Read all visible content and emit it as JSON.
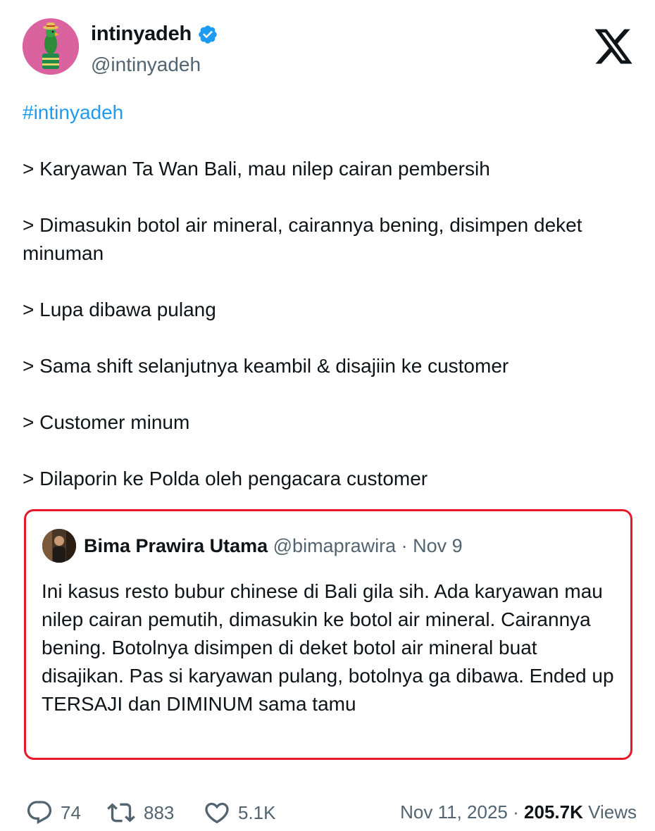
{
  "author": {
    "display_name": "intinyadeh",
    "handle": "@intinyadeh",
    "verified": true
  },
  "brand_logo": "x-logo",
  "post": {
    "hashtag": "#intinyadeh",
    "lines": [
      "> Karyawan Ta Wan Bali, mau nilep cairan pembersih",
      "> Dimasukin botol air mineral, cairannya bening, disimpen deket minuman",
      "> Lupa dibawa pulang",
      "> Sama shift selanjutnya keambil & disajiin ke customer",
      "> Customer minum",
      "> Dilaporin ke Polda oleh pengacara customer"
    ]
  },
  "quoted_post": {
    "display_name": "Bima Prawira Utama",
    "handle": "@bimaprawira",
    "separator": "·",
    "date": "Nov 9",
    "text": "Ini kasus resto bubur chinese di Bali gila sih. Ada karyawan mau nilep cairan pemutih, dimasukin ke botol air mineral. Cairannya bening. Botolnya disimpen di deket botol air mineral buat disajikan. Pas si karyawan pulang, botolnya ga dibawa. Ended up TERSAJI dan DIMINUM sama tamu",
    "highlight_border_color": "#e8182a"
  },
  "stats": {
    "replies": "74",
    "reposts": "883",
    "likes": "5.1K"
  },
  "meta": {
    "timestamp": "Nov 11, 2025",
    "separator": "·",
    "views_count": "205.7K",
    "views_label": "Views"
  },
  "colors": {
    "link": "#1d9bf0",
    "secondary_text": "#536471",
    "primary_text": "#0f1419",
    "verified_badge": "#1d9bf0",
    "avatar_bg": "#d9629f"
  }
}
